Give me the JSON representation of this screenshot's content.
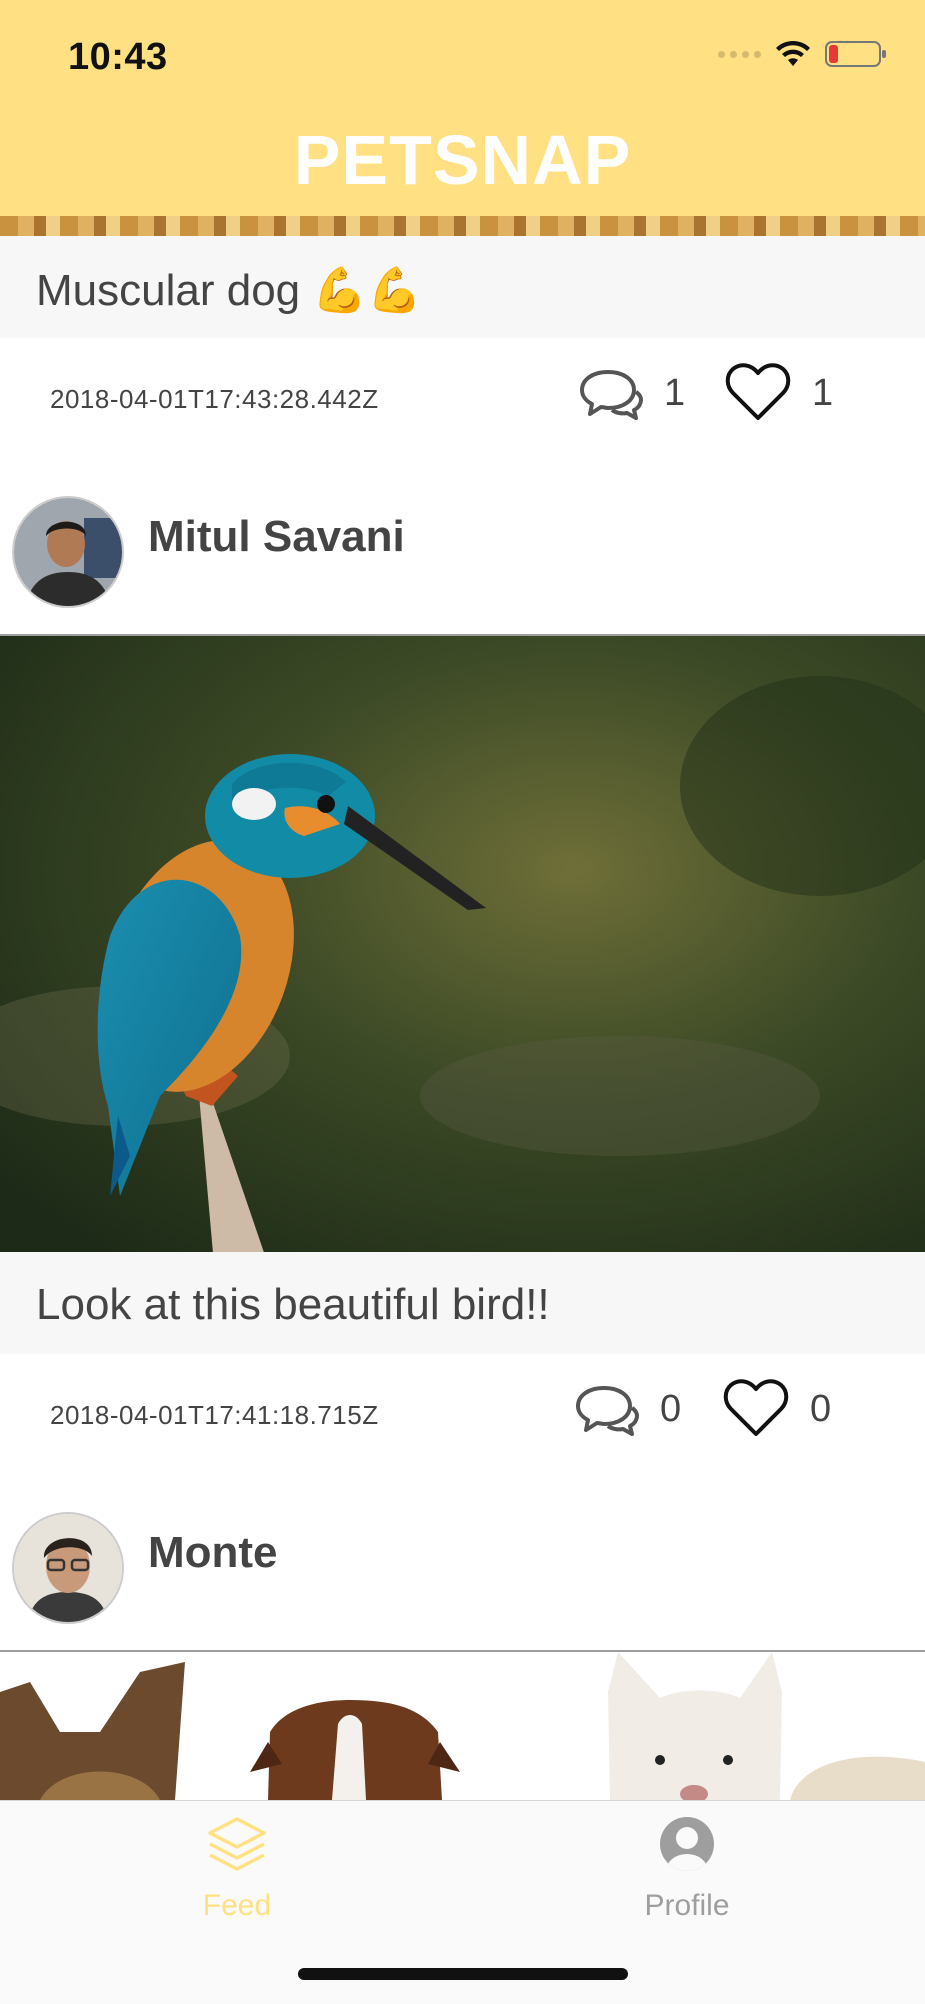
{
  "status_bar": {
    "time": "10:43"
  },
  "app": {
    "title": "PETSNAP"
  },
  "posts": [
    {
      "caption": "Muscular dog 💪💪",
      "timestamp": "2018-04-01T17:43:28.442Z",
      "comments": "1",
      "likes": "1",
      "author": "Mitul Savani"
    },
    {
      "caption": "Look at this beautiful bird!!",
      "timestamp": "2018-04-01T17:41:18.715Z",
      "comments": "0",
      "likes": "0",
      "author": "Monte"
    }
  ],
  "tabs": [
    {
      "label": "Feed",
      "icon": "layers-icon",
      "active": true
    },
    {
      "label": "Profile",
      "icon": "user-circle-icon",
      "active": false
    }
  ],
  "colors": {
    "header": "#FFE082",
    "active_tab": "#FFE082",
    "inactive_tab": "#9e9e9e"
  }
}
